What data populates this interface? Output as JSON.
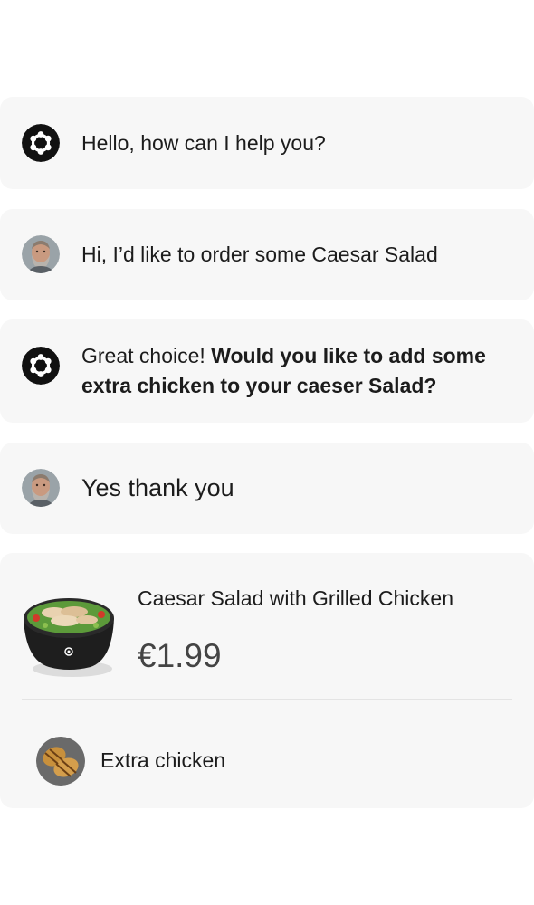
{
  "conversation": {
    "messages": [
      {
        "sender": "assistant",
        "avatar_icon": "assistant-logo-icon",
        "text": "Hello, how can I help you?"
      },
      {
        "sender": "user",
        "avatar_icon": "user-avatar",
        "text": "Hi, I’d like to order some Caesar Salad"
      },
      {
        "sender": "assistant",
        "avatar_icon": "assistant-logo-icon",
        "text_plain": "Great choice! ",
        "text_bold": "Would you like to add some extra chicken to your caeser Salad?"
      },
      {
        "sender": "user",
        "avatar_icon": "user-avatar",
        "text": "Yes thank you"
      }
    ]
  },
  "order": {
    "product_name": "Caesar Salad with Grilled Chicken",
    "product_price": "€1.99",
    "product_image_icon": "salad-bowl-image",
    "addon_label": "Extra chicken",
    "addon_image_icon": "grilled-chicken-image"
  },
  "colors": {
    "bubble_background": "#f7f7f7",
    "text": "#1c1c1c",
    "logo_background": "#111111"
  }
}
